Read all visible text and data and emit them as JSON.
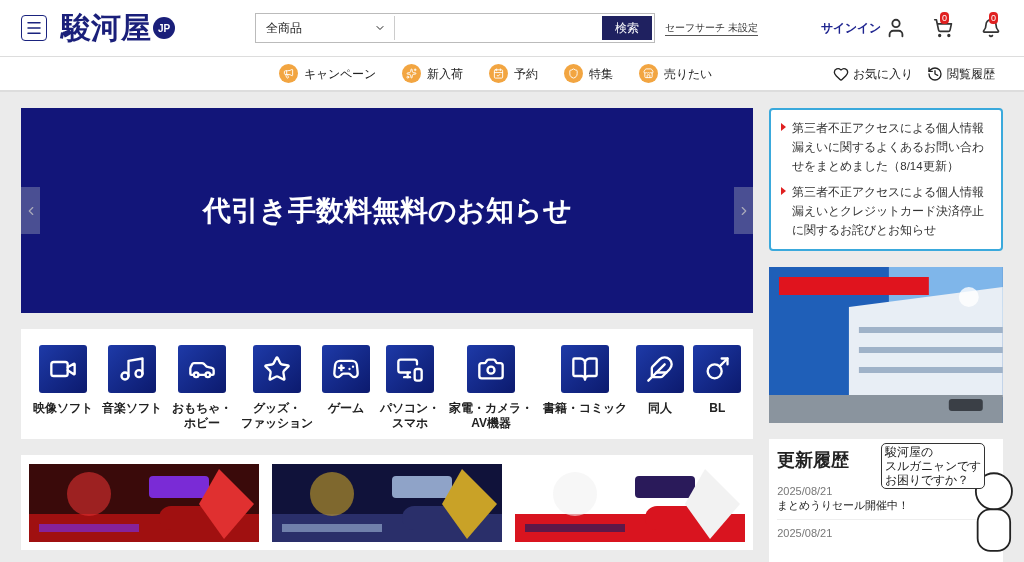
{
  "header": {
    "logo": {
      "name": "駿河屋",
      "suffix": "JP"
    },
    "search": {
      "category": "全商品",
      "button": "検索"
    },
    "safe_search": "セーフサーチ 未設定",
    "sign_in": "サインイン",
    "cart_count": "0",
    "notification_count": "0"
  },
  "nav": [
    {
      "label": "キャンペーン",
      "kind": "megaphone"
    },
    {
      "label": "新入荷",
      "kind": "new"
    },
    {
      "label": "予約",
      "kind": "reserve"
    },
    {
      "label": "特集",
      "kind": "feature"
    },
    {
      "label": "売りたい",
      "kind": "sell"
    }
  ],
  "nav_right": [
    {
      "label": "お気に入り",
      "kind": "heart"
    },
    {
      "label": "閲覧履歴",
      "kind": "history"
    }
  ],
  "hero": {
    "title": "代引き手数料無料のお知らせ"
  },
  "categories": [
    {
      "label": [
        "映像ソフト"
      ],
      "kind": "movie"
    },
    {
      "label": [
        "音楽ソフト"
      ],
      "kind": "music"
    },
    {
      "label": [
        "おもちゃ・",
        "ホビー"
      ],
      "kind": "toy"
    },
    {
      "label": [
        "グッズ・",
        "ファッション"
      ],
      "kind": "goods"
    },
    {
      "label": [
        "ゲーム"
      ],
      "kind": "game"
    },
    {
      "label": [
        "パソコン・",
        "スマホ"
      ],
      "kind": "pc"
    },
    {
      "label": [
        "家電・カメラ・",
        "AV機器"
      ],
      "kind": "camera"
    },
    {
      "label": [
        "書籍・コミック"
      ],
      "kind": "book"
    },
    {
      "label": [
        "同人"
      ],
      "kind": "doujin"
    },
    {
      "label": [
        "BL"
      ],
      "kind": "bl"
    }
  ],
  "notices": [
    "第三者不正アクセスによる個人情報漏えいに関するよくあるお問い合わせをまとめました（8/14更新）",
    "第三者不正アクセスによる個人情報漏えいとクレジットカード決済停止に関するお詫びとお知らせ"
  ],
  "updates": {
    "title": "更新履歴",
    "items": [
      {
        "date": "2025/08/21",
        "text": "まとめうりセール開催中！"
      },
      {
        "date": "2025/08/21"
      }
    ]
  },
  "assistant": {
    "bubble": [
      "駿河屋の",
      "スルガニャンです",
      "お困りですか？"
    ]
  }
}
